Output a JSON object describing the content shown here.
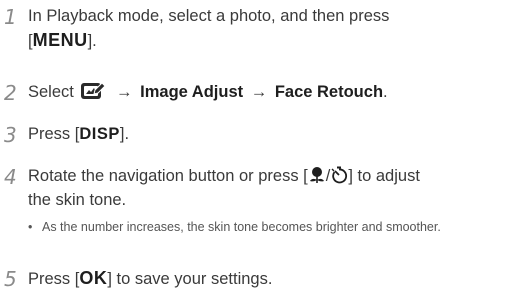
{
  "steps": [
    {
      "number": "1",
      "line1": "In Playback mode, select a photo, and then press",
      "bracket_open": "[",
      "key": "MENU",
      "bracket_close": "]."
    },
    {
      "number": "2",
      "prefix": "Select",
      "icon": "photo-edit-menu-icon",
      "arrow1": "→",
      "item1": "Image Adjust",
      "arrow2": "→",
      "item2": "Face Retouch",
      "suffix": "."
    },
    {
      "number": "3",
      "prefix": "Press [",
      "key": "DISP",
      "suffix": "]."
    },
    {
      "number": "4",
      "prefix": "Rotate the navigation button or press [",
      "icon_left": "macro-flower-icon",
      "slash": "/",
      "icon_right": "self-timer-icon",
      "suffix1": "] to adjust",
      "line2": "the skin tone.",
      "bullet": "As the number increases, the skin tone becomes brighter and smoother."
    },
    {
      "number": "5",
      "prefix": "Press [",
      "key": "OK",
      "suffix": "] to save your settings."
    }
  ],
  "colors": {
    "step_number": "#8a8a8a",
    "body_text": "#3a3a3a",
    "emphasis": "#1e1e1e"
  }
}
